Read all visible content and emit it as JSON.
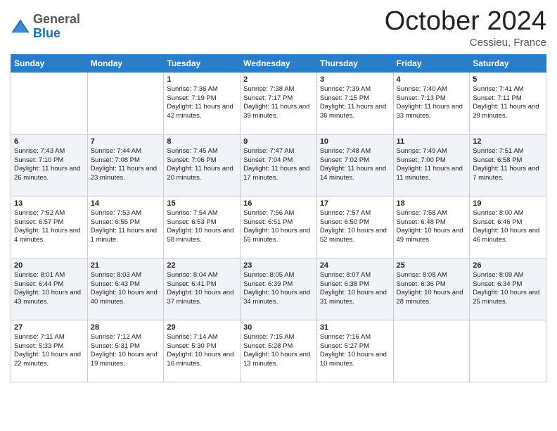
{
  "header": {
    "logo_general": "General",
    "logo_blue": "Blue",
    "month_title": "October 2024",
    "location": "Cessieu, France"
  },
  "days_of_week": [
    "Sunday",
    "Monday",
    "Tuesday",
    "Wednesday",
    "Thursday",
    "Friday",
    "Saturday"
  ],
  "weeks": [
    [
      {
        "num": "",
        "sunrise": "",
        "sunset": "",
        "daylight": ""
      },
      {
        "num": "",
        "sunrise": "",
        "sunset": "",
        "daylight": ""
      },
      {
        "num": "1",
        "sunrise": "Sunrise: 7:36 AM",
        "sunset": "Sunset: 7:19 PM",
        "daylight": "Daylight: 11 hours and 42 minutes."
      },
      {
        "num": "2",
        "sunrise": "Sunrise: 7:38 AM",
        "sunset": "Sunset: 7:17 PM",
        "daylight": "Daylight: 11 hours and 39 minutes."
      },
      {
        "num": "3",
        "sunrise": "Sunrise: 7:39 AM",
        "sunset": "Sunset: 7:15 PM",
        "daylight": "Daylight: 11 hours and 36 minutes."
      },
      {
        "num": "4",
        "sunrise": "Sunrise: 7:40 AM",
        "sunset": "Sunset: 7:13 PM",
        "daylight": "Daylight: 11 hours and 33 minutes."
      },
      {
        "num": "5",
        "sunrise": "Sunrise: 7:41 AM",
        "sunset": "Sunset: 7:11 PM",
        "daylight": "Daylight: 11 hours and 29 minutes."
      }
    ],
    [
      {
        "num": "6",
        "sunrise": "Sunrise: 7:43 AM",
        "sunset": "Sunset: 7:10 PM",
        "daylight": "Daylight: 11 hours and 26 minutes."
      },
      {
        "num": "7",
        "sunrise": "Sunrise: 7:44 AM",
        "sunset": "Sunset: 7:08 PM",
        "daylight": "Daylight: 11 hours and 23 minutes."
      },
      {
        "num": "8",
        "sunrise": "Sunrise: 7:45 AM",
        "sunset": "Sunset: 7:06 PM",
        "daylight": "Daylight: 11 hours and 20 minutes."
      },
      {
        "num": "9",
        "sunrise": "Sunrise: 7:47 AM",
        "sunset": "Sunset: 7:04 PM",
        "daylight": "Daylight: 11 hours and 17 minutes."
      },
      {
        "num": "10",
        "sunrise": "Sunrise: 7:48 AM",
        "sunset": "Sunset: 7:02 PM",
        "daylight": "Daylight: 11 hours and 14 minutes."
      },
      {
        "num": "11",
        "sunrise": "Sunrise: 7:49 AM",
        "sunset": "Sunset: 7:00 PM",
        "daylight": "Daylight: 11 hours and 11 minutes."
      },
      {
        "num": "12",
        "sunrise": "Sunrise: 7:51 AM",
        "sunset": "Sunset: 6:58 PM",
        "daylight": "Daylight: 11 hours and 7 minutes."
      }
    ],
    [
      {
        "num": "13",
        "sunrise": "Sunrise: 7:52 AM",
        "sunset": "Sunset: 6:57 PM",
        "daylight": "Daylight: 11 hours and 4 minutes."
      },
      {
        "num": "14",
        "sunrise": "Sunrise: 7:53 AM",
        "sunset": "Sunset: 6:55 PM",
        "daylight": "Daylight: 11 hours and 1 minute."
      },
      {
        "num": "15",
        "sunrise": "Sunrise: 7:54 AM",
        "sunset": "Sunset: 6:53 PM",
        "daylight": "Daylight: 10 hours and 58 minutes."
      },
      {
        "num": "16",
        "sunrise": "Sunrise: 7:56 AM",
        "sunset": "Sunset: 6:51 PM",
        "daylight": "Daylight: 10 hours and 55 minutes."
      },
      {
        "num": "17",
        "sunrise": "Sunrise: 7:57 AM",
        "sunset": "Sunset: 6:50 PM",
        "daylight": "Daylight: 10 hours and 52 minutes."
      },
      {
        "num": "18",
        "sunrise": "Sunrise: 7:58 AM",
        "sunset": "Sunset: 6:48 PM",
        "daylight": "Daylight: 10 hours and 49 minutes."
      },
      {
        "num": "19",
        "sunrise": "Sunrise: 8:00 AM",
        "sunset": "Sunset: 6:46 PM",
        "daylight": "Daylight: 10 hours and 46 minutes."
      }
    ],
    [
      {
        "num": "20",
        "sunrise": "Sunrise: 8:01 AM",
        "sunset": "Sunset: 6:44 PM",
        "daylight": "Daylight: 10 hours and 43 minutes."
      },
      {
        "num": "21",
        "sunrise": "Sunrise: 8:03 AM",
        "sunset": "Sunset: 6:43 PM",
        "daylight": "Daylight: 10 hours and 40 minutes."
      },
      {
        "num": "22",
        "sunrise": "Sunrise: 8:04 AM",
        "sunset": "Sunset: 6:41 PM",
        "daylight": "Daylight: 10 hours and 37 minutes."
      },
      {
        "num": "23",
        "sunrise": "Sunrise: 8:05 AM",
        "sunset": "Sunset: 6:39 PM",
        "daylight": "Daylight: 10 hours and 34 minutes."
      },
      {
        "num": "24",
        "sunrise": "Sunrise: 8:07 AM",
        "sunset": "Sunset: 6:38 PM",
        "daylight": "Daylight: 10 hours and 31 minutes."
      },
      {
        "num": "25",
        "sunrise": "Sunrise: 8:08 AM",
        "sunset": "Sunset: 6:36 PM",
        "daylight": "Daylight: 10 hours and 28 minutes."
      },
      {
        "num": "26",
        "sunrise": "Sunrise: 8:09 AM",
        "sunset": "Sunset: 6:34 PM",
        "daylight": "Daylight: 10 hours and 25 minutes."
      }
    ],
    [
      {
        "num": "27",
        "sunrise": "Sunrise: 7:11 AM",
        "sunset": "Sunset: 5:33 PM",
        "daylight": "Daylight: 10 hours and 22 minutes."
      },
      {
        "num": "28",
        "sunrise": "Sunrise: 7:12 AM",
        "sunset": "Sunset: 5:31 PM",
        "daylight": "Daylight: 10 hours and 19 minutes."
      },
      {
        "num": "29",
        "sunrise": "Sunrise: 7:14 AM",
        "sunset": "Sunset: 5:30 PM",
        "daylight": "Daylight: 10 hours and 16 minutes."
      },
      {
        "num": "30",
        "sunrise": "Sunrise: 7:15 AM",
        "sunset": "Sunset: 5:28 PM",
        "daylight": "Daylight: 10 hours and 13 minutes."
      },
      {
        "num": "31",
        "sunrise": "Sunrise: 7:16 AM",
        "sunset": "Sunset: 5:27 PM",
        "daylight": "Daylight: 10 hours and 10 minutes."
      },
      {
        "num": "",
        "sunrise": "",
        "sunset": "",
        "daylight": ""
      },
      {
        "num": "",
        "sunrise": "",
        "sunset": "",
        "daylight": ""
      }
    ]
  ]
}
